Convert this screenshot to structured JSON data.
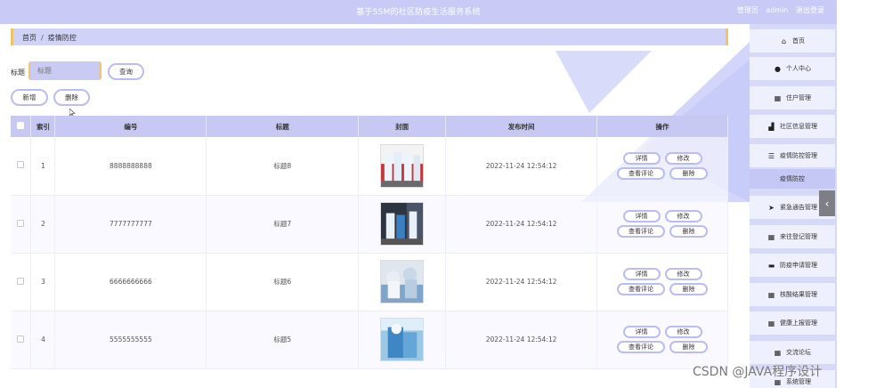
{
  "header": {
    "title": "基于SSM的社区防疫生活服务系统",
    "user_prefix": "管理员",
    "username": "admin",
    "logout": "退出登录"
  },
  "breadcrumb": {
    "home": "首页",
    "sep": "/",
    "current": "疫情防控"
  },
  "search": {
    "label": "标题",
    "placeholder": "标题",
    "query_button": "查询"
  },
  "actions": {
    "add": "新增",
    "delete": "删除"
  },
  "table": {
    "headers": [
      "索引",
      "编号",
      "标题",
      "封面",
      "发布时间",
      "操作"
    ],
    "rows": [
      {
        "index": "1",
        "code": "8888888888",
        "title": "标题8",
        "time": "2022-11-24 12:54:12"
      },
      {
        "index": "2",
        "code": "7777777777",
        "title": "标题7",
        "time": "2022-11-24 12:54:12"
      },
      {
        "index": "3",
        "code": "6666666666",
        "title": "标题6",
        "time": "2022-11-24 12:54:12"
      },
      {
        "index": "4",
        "code": "5555555555",
        "title": "标题5",
        "time": "2022-11-24 12:54:12"
      }
    ],
    "ops": {
      "detail": "详情",
      "edit": "修改",
      "comments": "查看评论",
      "delete": "删除"
    }
  },
  "sidebar": {
    "items": [
      {
        "label": "首页",
        "icon": "home-icon",
        "glyph": "⌂"
      },
      {
        "label": "个人中心",
        "icon": "user-icon",
        "glyph": "●"
      },
      {
        "label": "住户管理",
        "icon": "grid-icon",
        "glyph": "▦"
      },
      {
        "label": "社区信息管理",
        "icon": "chart-icon",
        "glyph": "▟"
      },
      {
        "label": "疫情防控管理",
        "icon": "list-icon",
        "glyph": "☰"
      },
      {
        "label": "疫情防控",
        "icon": "",
        "glyph": ""
      },
      {
        "label": "紧急通告管理",
        "icon": "send-icon",
        "glyph": "➤"
      },
      {
        "label": "来往登记管理",
        "icon": "grid-icon",
        "glyph": "▦"
      },
      {
        "label": "防疫申请管理",
        "icon": "card-icon",
        "glyph": "▬"
      },
      {
        "label": "核酸结果管理",
        "icon": "grid-icon",
        "glyph": "▦"
      },
      {
        "label": "健康上报管理",
        "icon": "grid-icon",
        "glyph": "▦"
      },
      {
        "label": "交流论坛",
        "icon": "grid-icon",
        "glyph": "▦"
      },
      {
        "label": "系统管理",
        "icon": "grid-icon",
        "glyph": "▦"
      }
    ]
  },
  "watermark": "CSDN @JAVA程序设计",
  "colors": {
    "accent": "#c9cbf6",
    "border": "#f2c46a",
    "button_border": "#b9bdf3"
  }
}
